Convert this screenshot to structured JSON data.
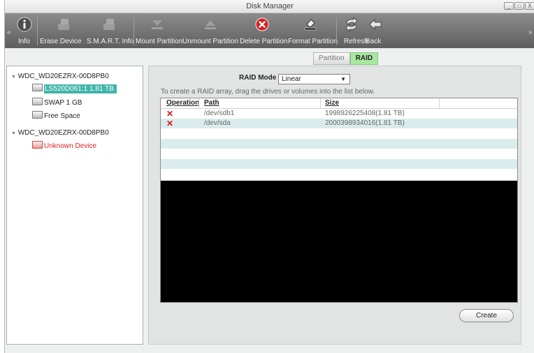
{
  "window": {
    "title": "Disk Manager",
    "buttons": [
      "_",
      "□",
      "X"
    ]
  },
  "toolbar": {
    "collapse_left": "«",
    "collapse_right": "»",
    "items": [
      {
        "label": "Info",
        "icon": "info-icon"
      },
      {
        "label": "Erase Device",
        "icon": "erase-device-icon"
      },
      {
        "label": "S.M.A.R.T. Info",
        "icon": "smart-info-icon"
      },
      {
        "label": "Mount Partition",
        "icon": "mount-partition-icon"
      },
      {
        "label": "Unmount Partition",
        "icon": "unmount-partition-icon"
      },
      {
        "label": "Delete Partition",
        "icon": "delete-partition-icon"
      },
      {
        "label": "Format Partition",
        "icon": "format-partition-icon"
      },
      {
        "label": "Refresh",
        "icon": "refresh-icon"
      },
      {
        "label": "Back",
        "icon": "back-icon"
      }
    ]
  },
  "tree": {
    "disks": [
      {
        "name": "WDC_WD20EZRX-00D8PB0",
        "children": [
          {
            "label": "LS520D061:1 1.81 TB",
            "selected": true
          },
          {
            "label": "SWAP 1 GB"
          },
          {
            "label": "Free Space"
          }
        ]
      },
      {
        "name": "WDC_WD20EZRX-00D8PB0",
        "children": [
          {
            "label": "Unknown Device",
            "status": "error"
          }
        ]
      }
    ],
    "expand_glyph": "▼"
  },
  "tabs": [
    {
      "label": "Partition",
      "active": false
    },
    {
      "label": "RAID",
      "active": true
    }
  ],
  "raid": {
    "mode_label": "RAID Mode",
    "mode_value": "Linear",
    "hint": "To create a RAID array, drag the drives or volumes into the list below.",
    "columns": [
      "Operation",
      "Path",
      "Size"
    ],
    "rows": [
      {
        "operation": "remove",
        "path": "/dev/sdb1",
        "size": "1998926225408(1.81 TB)"
      },
      {
        "operation": "remove",
        "path": "/dev/sda",
        "size": "2000398934016(1.81 TB)"
      }
    ],
    "create_label": "Create"
  },
  "colors": {
    "accent": "#41b5aa",
    "active_tab": "#a7e8a1",
    "error": "#e02020",
    "row_alt": "#daecec"
  }
}
